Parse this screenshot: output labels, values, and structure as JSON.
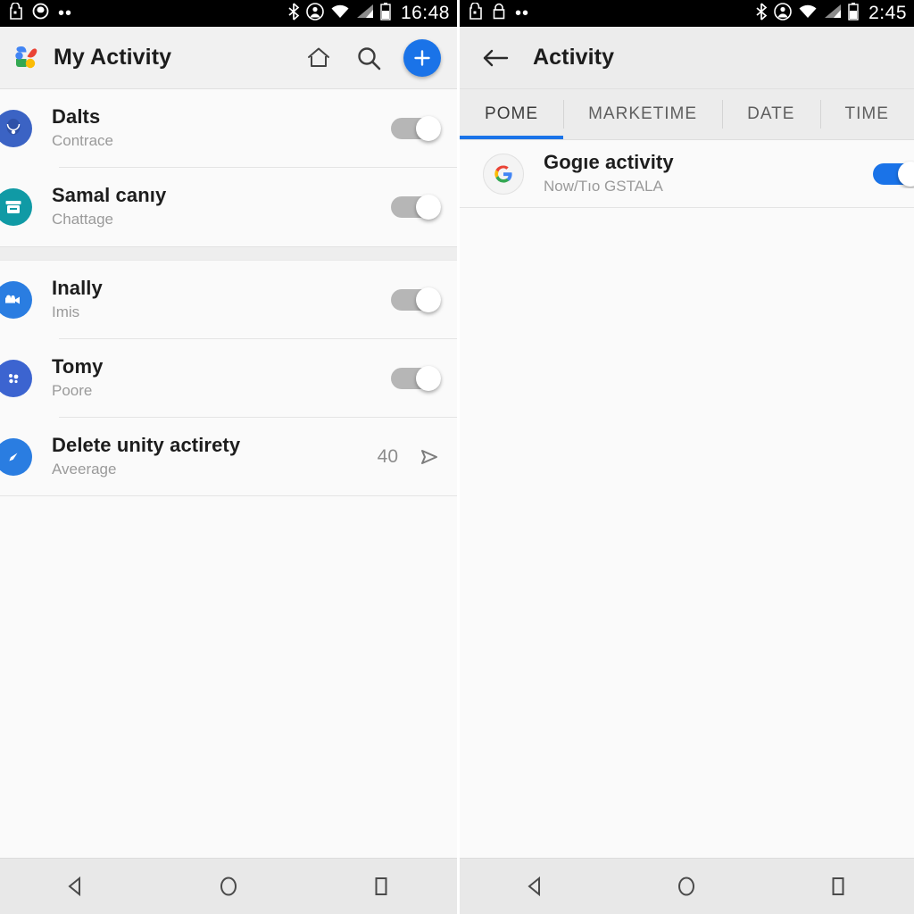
{
  "left_screen": {
    "status_bar": {
      "time": "16:48",
      "left_icons": [
        "bag-icon",
        "heart-outline-icon",
        "more-dots-icon"
      ],
      "right_icons": [
        "bluetooth-icon",
        "account-icon",
        "wifi-icon",
        "signal-icon",
        "battery-icon"
      ]
    },
    "app_bar": {
      "title": "My Activity",
      "logo": "google-photos-logo-icon",
      "actions": [
        {
          "name": "home-icon",
          "label": "Home"
        },
        {
          "name": "search-icon",
          "label": "Search"
        },
        {
          "name": "add-fab-icon",
          "label": "Add"
        }
      ]
    },
    "rows": [
      {
        "title": "Dalts",
        "subtitle": "Contrace",
        "icon": "necklace-icon",
        "icon_color": "#3b63c4",
        "toggle": "off"
      },
      {
        "title": "Samal canıy",
        "subtitle": "Chattage",
        "icon": "archive-box-icon",
        "icon_color": "#109aa5",
        "toggle": "off"
      },
      {
        "title": "Inally",
        "subtitle": "Imis",
        "icon": "video-camera-icon",
        "icon_color": "#2a7de1",
        "toggle": "off"
      },
      {
        "title": "Tomy",
        "subtitle": "Poore",
        "icon": "dots-face-icon",
        "icon_color": "#3c64d0",
        "toggle": "off"
      },
      {
        "title": "Delete unity actirety",
        "subtitle": "Aveerage",
        "icon": "compass-needle-icon",
        "icon_color": "#2a7de1",
        "value": "40",
        "chevron": "send-arrow-icon"
      }
    ],
    "nav_bar": [
      "back-triangle-icon",
      "home-circle-icon",
      "recents-square-icon"
    ]
  },
  "right_screen": {
    "status_bar": {
      "time": "2:45",
      "left_icons": [
        "bag-icon",
        "lock-bag-icon",
        "more-dots-icon"
      ],
      "right_icons": [
        "bluetooth-icon",
        "account-icon",
        "wifi-icon",
        "signal-icon",
        "battery-icon"
      ]
    },
    "app_bar": {
      "title": "Activity",
      "back": "back-arrow-icon"
    },
    "tabs": [
      {
        "label": "POME",
        "active": true
      },
      {
        "label": "MARKETIME",
        "active": false
      },
      {
        "label": "DATE",
        "active": false
      },
      {
        "label": "TIME",
        "active": false
      }
    ],
    "rows": [
      {
        "title": "Gogıe activity",
        "subtitle": "Now/Tıo GSTALA",
        "icon": "google-g-icon",
        "toggle": "on"
      }
    ],
    "nav_bar": [
      "back-triangle-icon",
      "home-circle-icon",
      "recents-square-icon"
    ]
  },
  "colors": {
    "accent": "#1a73e8",
    "toggle_off_track": "#b6b6b6",
    "status_bar_bg": "#000000",
    "app_bar_bg": "#f1f1f1",
    "page_bg": "#fafafa"
  }
}
